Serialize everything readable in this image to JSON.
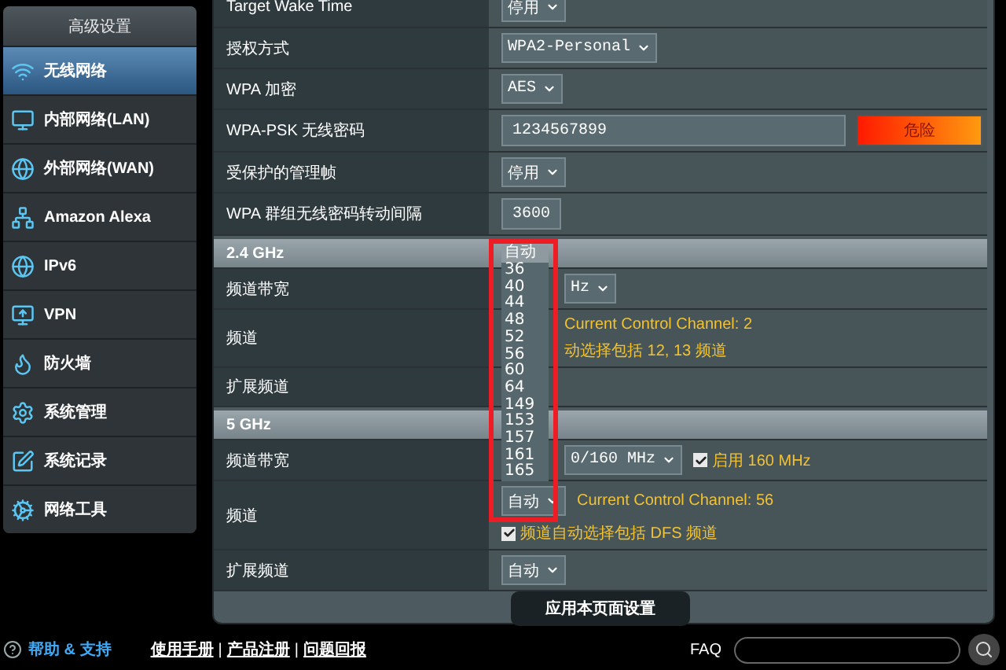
{
  "sidebar": {
    "title": "高级设置",
    "items": [
      {
        "label": "无线网络",
        "selected": true
      },
      {
        "label": "内部网络(LAN)",
        "selected": false
      },
      {
        "label": "外部网络(WAN)",
        "selected": false
      },
      {
        "label": "Amazon Alexa",
        "selected": false
      },
      {
        "label": "IPv6",
        "selected": false
      },
      {
        "label": "VPN",
        "selected": false
      },
      {
        "label": "防火墙",
        "selected": false
      },
      {
        "label": "系统管理",
        "selected": false
      },
      {
        "label": "系统记录",
        "selected": false
      },
      {
        "label": "网络工具",
        "selected": false
      }
    ]
  },
  "settings": [
    {
      "label": "Target Wake Time",
      "lines": [
        [
          {
            "kind": "select",
            "value": "停用"
          }
        ]
      ]
    },
    {
      "label": "授权方式",
      "lines": [
        [
          {
            "kind": "select",
            "value": "WPA2-Personal"
          }
        ]
      ]
    },
    {
      "label": "WPA 加密",
      "lines": [
        [
          {
            "kind": "select",
            "value": "AES"
          }
        ]
      ]
    },
    {
      "label": "WPA-PSK 无线密码",
      "lines": [
        [
          {
            "kind": "input",
            "value": "1234567899"
          },
          {
            "kind": "strength",
            "label": "危险"
          }
        ]
      ]
    },
    {
      "label": "受保护的管理帧",
      "lines": [
        [
          {
            "kind": "select",
            "value": "停用"
          }
        ]
      ]
    },
    {
      "label": "WPA 群组无线密码转动间隔",
      "lines": [
        [
          {
            "kind": "input",
            "value": "3600"
          }
        ]
      ]
    }
  ],
  "sections": [
    {
      "title": "2.4 GHz",
      "rows": [
        {
          "label": "频道带宽",
          "lines": [
            [
              {
                "kind": "select",
                "value": "Hz"
              }
            ]
          ]
        },
        {
          "label": "频道",
          "lines": [
            [
              {
                "kind": "note",
                "text": "Current Control Channel: 2"
              }
            ],
            [
              {
                "kind": "note",
                "text": "动选择包括 12, 13 频道"
              }
            ]
          ]
        },
        {
          "label": "扩展频道",
          "lines": []
        }
      ]
    },
    {
      "title": "5 GHz",
      "rows": [
        {
          "label": "频道带宽",
          "lines": [
            [
              {
                "kind": "select",
                "value": "0/160 MHz"
              },
              {
                "kind": "checkbox",
                "checked": true,
                "label": "启用 160 MHz"
              }
            ]
          ]
        },
        {
          "label": "频道",
          "lines": [
            [
              {
                "kind": "select",
                "value": "自动",
                "open": true,
                "options": [
                  {
                    "label": "自动",
                    "selected": true
                  },
                  {
                    "label": "36",
                    "selected": false
                  },
                  {
                    "label": "40",
                    "selected": false
                  },
                  {
                    "label": "44",
                    "selected": false
                  },
                  {
                    "label": "48",
                    "selected": false
                  },
                  {
                    "label": "52",
                    "selected": false
                  },
                  {
                    "label": "56",
                    "selected": false
                  },
                  {
                    "label": "60",
                    "selected": false
                  },
                  {
                    "label": "64",
                    "selected": false
                  },
                  {
                    "label": "149",
                    "selected": false
                  },
                  {
                    "label": "153",
                    "selected": false
                  },
                  {
                    "label": "157",
                    "selected": false
                  },
                  {
                    "label": "161",
                    "selected": false
                  },
                  {
                    "label": "165",
                    "selected": false
                  }
                ]
              },
              {
                "kind": "note",
                "text": "Current Control Channel: 56"
              }
            ],
            [
              {
                "kind": "checkbox",
                "checked": true,
                "label": "频道自动选择包括 DFS 频道"
              }
            ]
          ]
        },
        {
          "label": "扩展频道",
          "lines": [
            [
              {
                "kind": "select",
                "value": "自动"
              }
            ]
          ]
        }
      ]
    }
  ],
  "apply_button": "应用本页面设置",
  "footer": {
    "help": "帮助 & 支持",
    "links": [
      "使用手册",
      "产品注册",
      "问题回报"
    ],
    "separator": "|",
    "faq": "FAQ"
  }
}
